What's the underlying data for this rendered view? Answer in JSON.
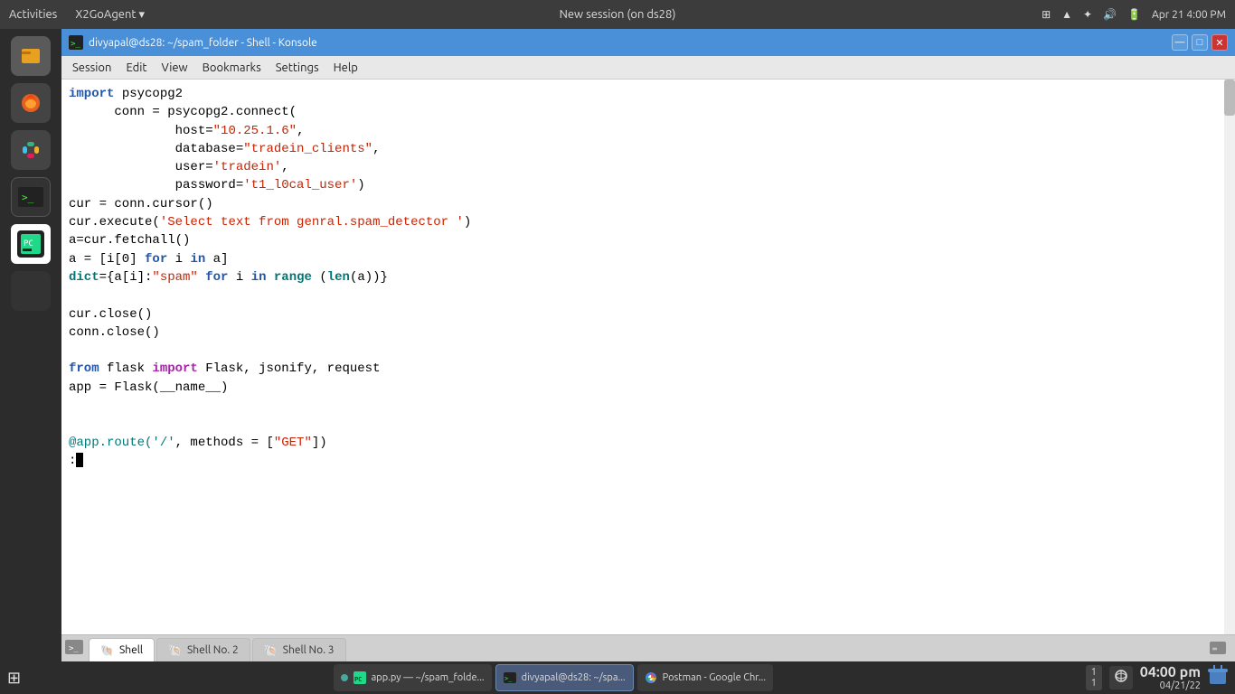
{
  "topbar": {
    "left": [
      "Activities",
      "X2GoAgent ▾"
    ],
    "center": "New session (on ds28)",
    "datetime": "Apr 21   4:00 PM"
  },
  "konsole": {
    "title": "divyapal@ds28: ~/spam_folder - Shell - Konsole",
    "menu_items": [
      "Session",
      "Edit",
      "View",
      "Bookmarks",
      "Settings",
      "Help"
    ]
  },
  "tabs": [
    {
      "label": "Shell",
      "active": true
    },
    {
      "label": "Shell No. 2",
      "active": false
    },
    {
      "label": "Shell No. 3",
      "active": false
    }
  ],
  "taskbar": {
    "apps": [
      {
        "label": "app.py — ~/spam_folde..."
      },
      {
        "label": "divyapal@ds28: ~/spa..."
      },
      {
        "label": "Postman - Google Chr..."
      }
    ],
    "clock_time": "04:00 pm",
    "clock_date": "04/21/22"
  }
}
